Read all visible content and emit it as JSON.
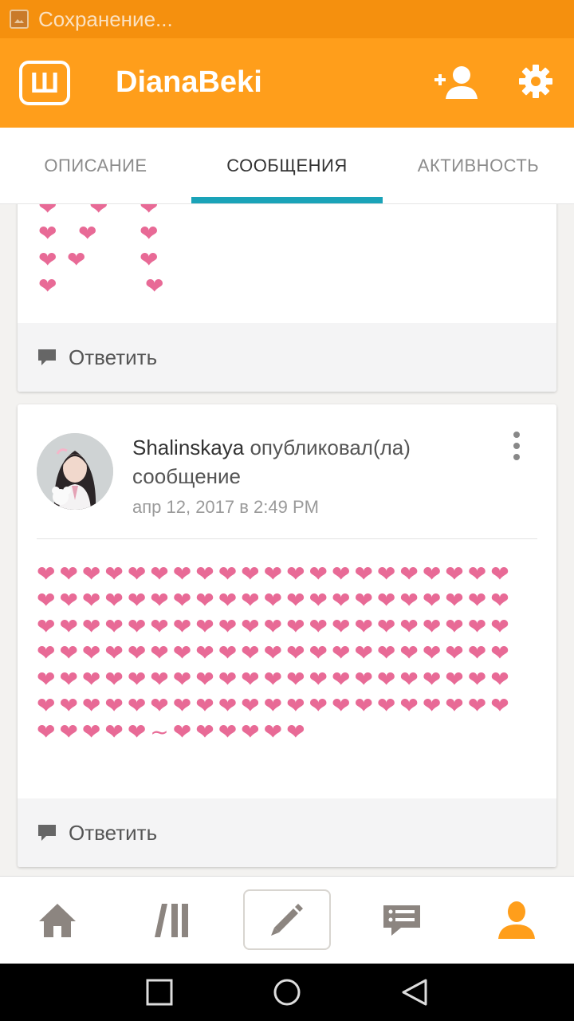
{
  "status_bar": {
    "text": "Сохранение..."
  },
  "app_bar": {
    "logo_text": "Ш",
    "title": "DianaBeki"
  },
  "tabs": [
    {
      "label": "ОПИСАНИЕ",
      "active": false
    },
    {
      "label": "СООБЩЕНИЯ",
      "active": true
    },
    {
      "label": "АКТИВНОСТЬ",
      "active": false
    }
  ],
  "accent_color": "#ff9e1b",
  "tab_indicator_color": "#1aa3b8",
  "heart_color": "#e86a96",
  "posts": [
    {
      "reply_label": "Ответить"
    },
    {
      "author": "Shalinskaya",
      "action": "опубликовал(ла) сообщение",
      "date": "апр 12, 2017 в 2:49 PM",
      "body": "❤❤❤❤❤❤❤❤❤❤❤❤❤❤❤❤❤❤❤❤❤❤❤❤❤❤❤❤❤❤❤❤❤❤❤❤❤❤❤❤❤❤❤❤❤❤❤❤❤❤❤❤❤❤❤❤❤❤❤❤❤❤❤❤❤❤❤❤❤❤❤❤❤❤❤❤❤❤❤❤❤❤❤❤❤❤❤❤❤❤❤❤❤❤❤❤❤❤❤❤❤❤❤❤❤❤❤❤❤❤❤❤❤❤❤❤❤❤❤❤❤❤❤❤❤❤❤❤❤❤❤~❤❤❤❤❤❤",
      "reply_label": "Ответить"
    }
  ],
  "bottom_nav": [
    {
      "icon": "home-icon"
    },
    {
      "icon": "library-icon"
    },
    {
      "icon": "pencil-icon"
    },
    {
      "icon": "messages-icon"
    },
    {
      "icon": "profile-icon"
    }
  ]
}
